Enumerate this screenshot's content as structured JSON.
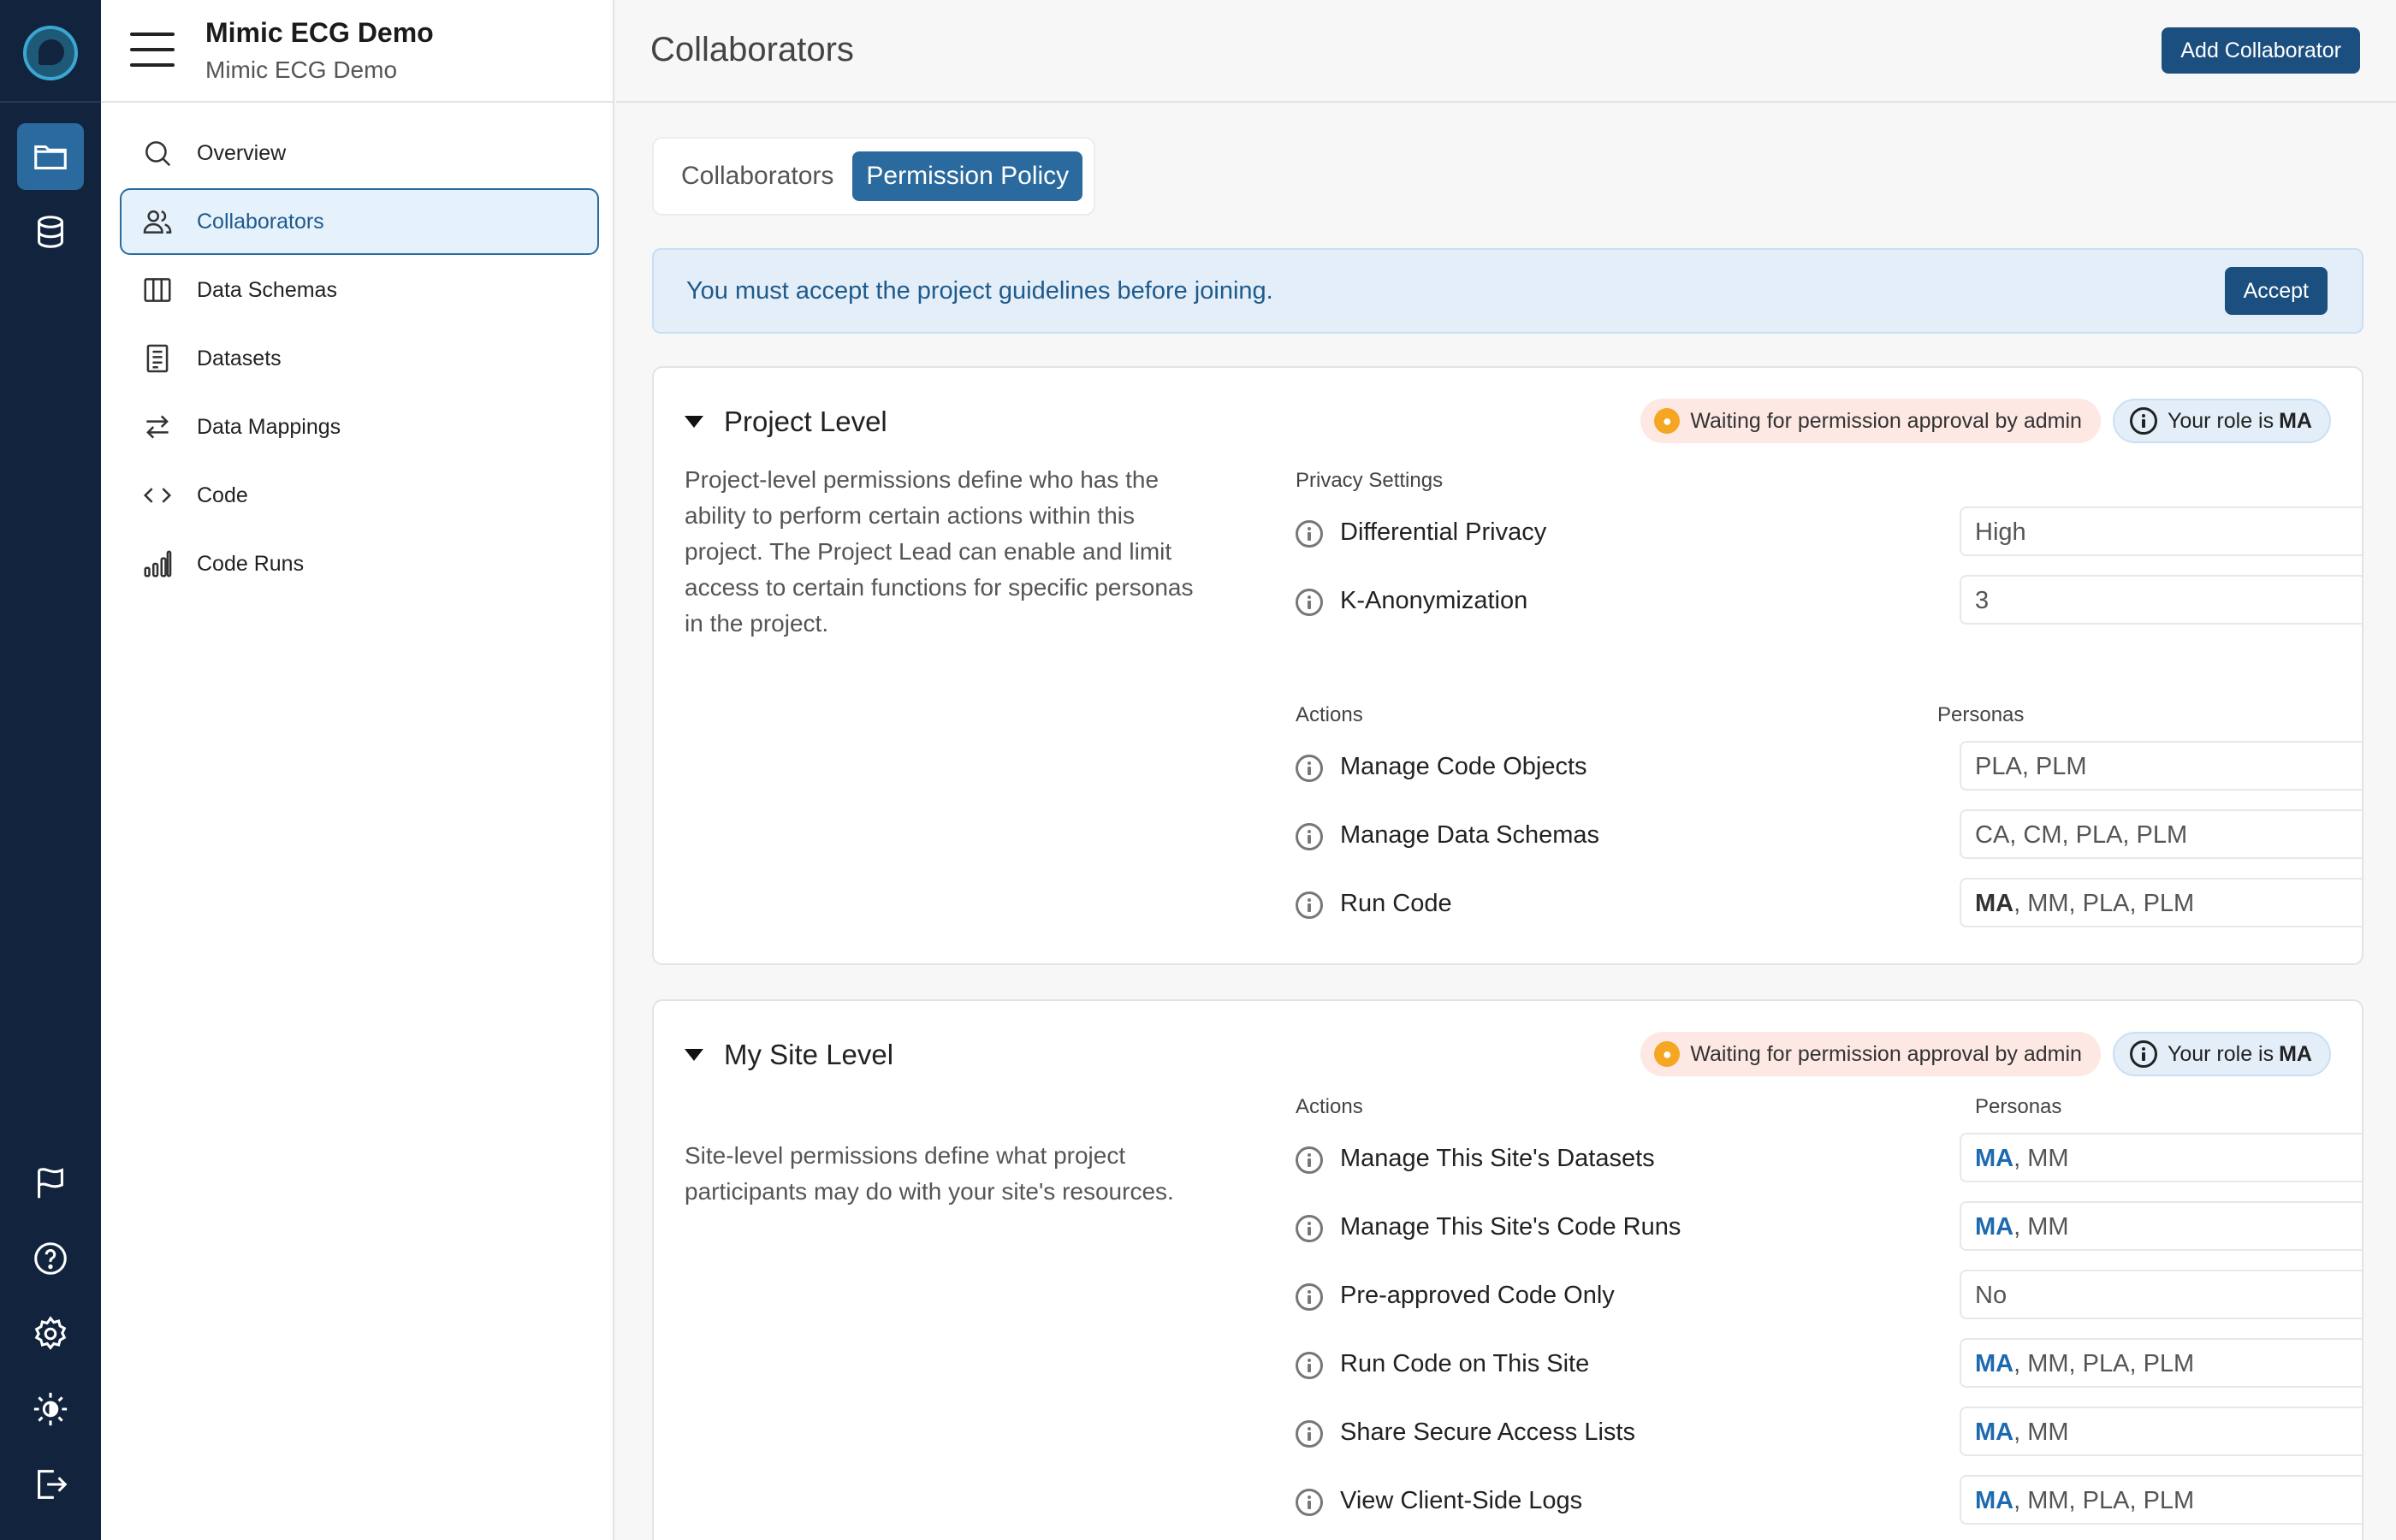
{
  "app": {
    "project_title": "Mimic ECG Demo",
    "project_subtitle": "Mimic ECG Demo"
  },
  "rail": {
    "items": [
      {
        "name": "projects-folder-icon",
        "active": true
      },
      {
        "name": "database-icon",
        "active": false
      },
      {
        "name": "flag-icon",
        "active": false
      },
      {
        "name": "help-icon",
        "active": false
      },
      {
        "name": "gear-icon",
        "active": false
      },
      {
        "name": "theme-toggle-icon",
        "active": false
      },
      {
        "name": "logout-icon",
        "active": false
      }
    ]
  },
  "sidebar": {
    "items": [
      {
        "label": "Overview",
        "icon": "search-icon",
        "active": false
      },
      {
        "label": "Collaborators",
        "icon": "users-icon",
        "active": true
      },
      {
        "label": "Data Schemas",
        "icon": "columns-icon",
        "active": false
      },
      {
        "label": "Datasets",
        "icon": "document-icon",
        "active": false
      },
      {
        "label": "Data Mappings",
        "icon": "arrows-icon",
        "active": false
      },
      {
        "label": "Code",
        "icon": "code-icon",
        "active": false
      },
      {
        "label": "Code Runs",
        "icon": "bar-chart-icon",
        "active": false
      }
    ]
  },
  "header": {
    "title": "Collaborators",
    "add_button": "Add Collaborator"
  },
  "tabs": [
    {
      "label": "Collaborators",
      "active": false
    },
    {
      "label": "Permission Policy",
      "active": true
    }
  ],
  "banner": {
    "text": "You must accept the project guidelines before joining.",
    "button": "Accept"
  },
  "project_level": {
    "title": "Project Level",
    "status_badge": "Waiting for permission approval by admin",
    "role_prefix": "Your role is",
    "role": "MA",
    "description": "Project-level permissions define who has the ability to perform certain actions within this project. The Project Lead can enable and limit access to certain functions for specific personas in the project.",
    "privacy_header": "Privacy Settings",
    "privacy": [
      {
        "label": "Differential Privacy",
        "value": "High"
      },
      {
        "label": "K-Anonymization",
        "value": "3"
      }
    ],
    "actions_header": "Actions",
    "personas_header": "Personas",
    "actions": [
      {
        "label": "Manage Code Objects",
        "first": "",
        "rest": "PLA, PLM"
      },
      {
        "label": "Manage Data Schemas",
        "first": "",
        "rest": "CA, CM, PLA, PLM"
      },
      {
        "label": "Run Code",
        "first": "MA",
        "rest": ", MM, PLA, PLM"
      }
    ]
  },
  "site_level": {
    "title": "My Site Level",
    "status_badge": "Waiting for permission approval by admin",
    "role_prefix": "Your role is",
    "role": "MA",
    "description": "Site-level permissions define what project participants may do with your site's resources.",
    "actions_header": "Actions",
    "personas_header": "Personas",
    "actions": [
      {
        "label": "Manage This Site's Datasets",
        "first": "MA",
        "rest": ", MM"
      },
      {
        "label": "Manage This Site's Code Runs",
        "first": "MA",
        "rest": ", MM"
      },
      {
        "label": "Pre-approved Code Only",
        "first": "",
        "rest": "No"
      },
      {
        "label": "Run Code on This Site",
        "first": "MA",
        "rest": ", MM, PLA, PLM"
      },
      {
        "label": "Share Secure Access Lists",
        "first": "MA",
        "rest": ", MM"
      },
      {
        "label": "View Client-Side Logs",
        "first": "MA",
        "rest": ", MM, PLA, PLM"
      }
    ]
  },
  "colors": {
    "rail": "#12233d",
    "accent": "#2b6a9e",
    "button": "#1b4f7f",
    "link": "#1e6ab0"
  }
}
